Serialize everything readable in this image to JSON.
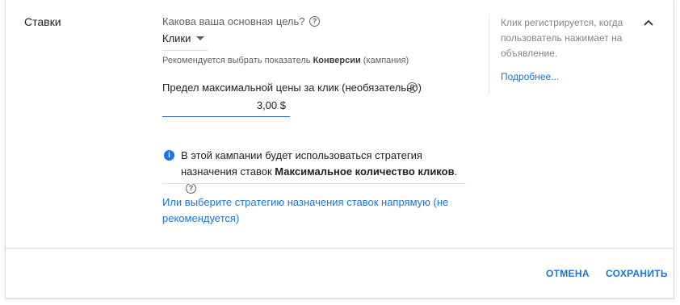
{
  "section": {
    "title": "Ставки"
  },
  "goal": {
    "label": "Какова ваша основная цель?",
    "selected": "Клики",
    "recommendation_prefix": "Рекомендуется выбрать показатель ",
    "recommendation_metric": "Конверсии",
    "recommendation_suffix": " (кампания)"
  },
  "max_cpc": {
    "label": "Предел максимальной цены за клик (необязательно)",
    "value": "3,00 $"
  },
  "info": {
    "text_before": "В этой кампании будет использоваться стратегия назначения ставок ",
    "strategy": "Максимальное количество кликов",
    "text_after": "."
  },
  "choose_strategy_link": "Или выберите стратегию назначения ставок напрямую (не рекомендуется)",
  "side_panel": {
    "description": "Клик регистрируется, когда пользователь нажимает на объявление.",
    "more_link": "Подробнее..."
  },
  "actions": {
    "cancel": "ОТМЕНА",
    "save": "СОХРАНИТЬ"
  },
  "icons": {
    "help": "question-circle-icon",
    "info": "info-icon",
    "collapse": "chevron-up-icon",
    "dropdown": "caret-down-icon"
  },
  "colors": {
    "accent": "#1a73e8",
    "muted_text": "#5f6368",
    "side_text": "#80868b"
  }
}
